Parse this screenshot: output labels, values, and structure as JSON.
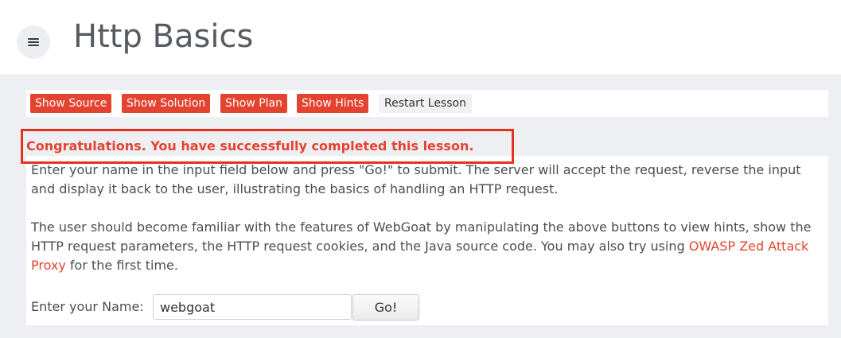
{
  "header": {
    "title": "Http Basics",
    "menu_icon": "hamburger-icon"
  },
  "toolbar": {
    "show_source": "Show Source",
    "show_solution": "Show Solution",
    "show_plan": "Show Plan",
    "show_hints": "Show Hints",
    "restart_lesson": "Restart Lesson"
  },
  "lesson": {
    "success_message": "Congratulations. You have successfully completed this lesson.",
    "paragraph1": "Enter your name in the input field below and press \"Go!\" to submit. The server will accept the request, reverse the input and display it back to the user, illustrating the basics of handling an HTTP request.",
    "paragraph2_before_link": "The user should become familiar with the features of WebGoat by manipulating the above buttons to view hints, show the HTTP request parameters, the HTTP request cookies, and the Java source code. You may also try using ",
    "paragraph2_link": "OWASP Zed Attack Proxy",
    "paragraph2_after_link": " for the first time."
  },
  "form": {
    "name_label": "Enter your Name:",
    "name_value": "webgoat",
    "go_label": "Go!"
  },
  "colors": {
    "accent_red": "#e4432f",
    "highlight_border": "#e5321f",
    "background": "#eeeff3"
  }
}
